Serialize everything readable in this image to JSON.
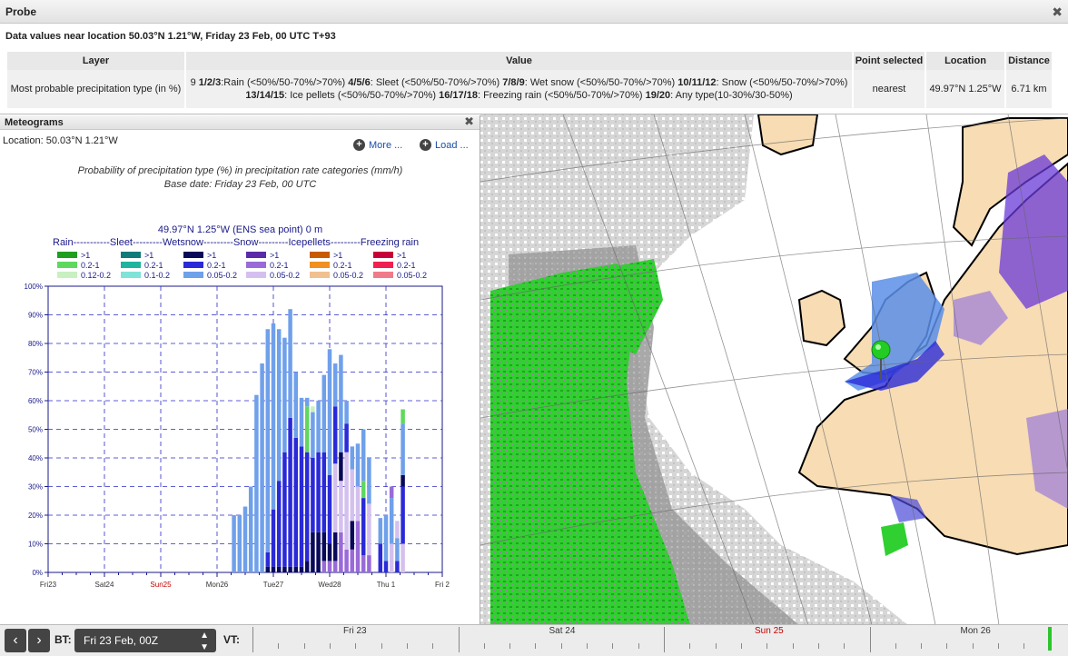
{
  "probe": {
    "title": "Probe",
    "subtitle": "Data values near location 50.03°N 1.21°W, Friday 23 Feb, 00 UTC T+93",
    "headers": [
      "Layer",
      "Value",
      "Point selected",
      "Location",
      "Distance"
    ],
    "row": {
      "layer": "Most probable precipitation type (in %)",
      "value_line1_prefix": "9 ",
      "value_line1": [
        {
          "b": "1/2/3",
          "t": ":Rain (<50%/50-70%/>70%) "
        },
        {
          "b": "4/5/6",
          "t": ": Sleet (<50%/50-70%/>70%) "
        },
        {
          "b": "7/8/9",
          "t": ": Wet snow (<50%/50-70%/>70%) "
        },
        {
          "b": "10/11/12",
          "t": ": Snow (<50%/50-70%/>70%)"
        }
      ],
      "value_line2": [
        {
          "b": "13/14/15",
          "t": ": Ice pellets (<50%/50-70%/>70%) "
        },
        {
          "b": "16/17/18",
          "t": ": Freezing rain (<50%/50-70%/>70%) "
        },
        {
          "b": "19/20",
          "t": ": Any type(10-30%/30-50%)"
        }
      ],
      "point_selected": "nearest",
      "location": "49.97°N 1.25°W",
      "distance": "6.71 km"
    }
  },
  "meteogram": {
    "title": "Meteograms",
    "location": "Location: 50.03°N 1.21°W",
    "more_label": "More ...",
    "load_label": "Load ...",
    "chart_title": "Probability of precipitation type (%) in precipitation rate categories (mm/h)",
    "base_date": "Base date: Friday 23 Feb, 00 UTC",
    "point_label": "49.97°N 1.25°W (ENS sea point) 0 m",
    "legend_header": "Rain-----------Sleet---------Wetsnow---------Snow---------Icepellets---------Freezing rain",
    "legend": [
      {
        "items": [
          {
            "label": ">1",
            "color": "#1f9e1f"
          },
          {
            "label": "0.2-1",
            "color": "#5fd85f"
          },
          {
            "label": "0.12-0.2",
            "color": "#c8f0c0"
          }
        ]
      },
      {
        "items": [
          {
            "label": ">1",
            "color": "#117a7a"
          },
          {
            "label": "0.2-1",
            "color": "#1fb3a0"
          },
          {
            "label": "0.1-0.2",
            "color": "#7fe3d8"
          }
        ]
      },
      {
        "items": [
          {
            "label": ">1",
            "color": "#0a0a5a"
          },
          {
            "label": "0.2-1",
            "color": "#2a2ad8"
          },
          {
            "label": "0.05-0.2",
            "color": "#6fa0ea"
          }
        ]
      },
      {
        "items": [
          {
            "label": ">1",
            "color": "#5a2aa8"
          },
          {
            "label": "0.2-1",
            "color": "#9a6ad8"
          },
          {
            "label": "0.05-0.2",
            "color": "#d4c0ee"
          }
        ]
      },
      {
        "items": [
          {
            "label": ">1",
            "color": "#c85a00"
          },
          {
            "label": "0.2-1",
            "color": "#f09020"
          },
          {
            "label": "0.05-0.2",
            "color": "#f0c090"
          }
        ]
      },
      {
        "items": [
          {
            "label": ">1",
            "color": "#c8003a"
          },
          {
            "label": "0.2-1",
            "color": "#f02050"
          },
          {
            "label": "0.05-0.2",
            "color": "#f07a8a"
          }
        ]
      }
    ]
  },
  "chart_data": {
    "type": "bar",
    "stacked": true,
    "ylim": [
      0,
      100
    ],
    "yticks": [
      "0%",
      "10%",
      "20%",
      "30%",
      "40%",
      "50%",
      "60%",
      "70%",
      "80%",
      "90%",
      "100%"
    ],
    "xticks": [
      {
        "label": "Fri23",
        "day": 0,
        "color": "#333"
      },
      {
        "label": "Sat24",
        "day": 1,
        "color": "#333"
      },
      {
        "label": "Sun25",
        "day": 2,
        "color": "#c00000"
      },
      {
        "label": "Mon26",
        "day": 3,
        "color": "#333"
      },
      {
        "label": "Tue27",
        "day": 4,
        "color": "#333"
      },
      {
        "label": "Wed28",
        "day": 5,
        "color": "#333"
      },
      {
        "label": "Thu 1",
        "day": 6,
        "color": "#333"
      },
      {
        "label": "Fri 2",
        "day": 7,
        "color": "#333"
      }
    ],
    "grid": true,
    "series_colors": {
      "wet_light": "#6fa0ea",
      "wet_mid": "#2a2ad8",
      "wet_heavy": "#0a0a5a",
      "snow_light": "#d4c0ee",
      "snow_mid": "#9a6ad8",
      "snow_heavy": "#5a2aa8",
      "rain_mid": "#5fd85f",
      "rain_light": "#c8f0c0",
      "sleet_light": "#7fe3d8"
    },
    "bars": [
      {
        "t": 3.3,
        "s": [
          [
            "wet_light",
            20
          ]
        ]
      },
      {
        "t": 3.4,
        "s": [
          [
            "wet_light",
            20
          ]
        ]
      },
      {
        "t": 3.5,
        "s": [
          [
            "wet_light",
            23
          ]
        ]
      },
      {
        "t": 3.6,
        "s": [
          [
            "wet_light",
            30
          ]
        ]
      },
      {
        "t": 3.7,
        "s": [
          [
            "wet_light",
            62
          ]
        ]
      },
      {
        "t": 3.8,
        "s": [
          [
            "wet_light",
            73
          ]
        ]
      },
      {
        "t": 3.9,
        "s": [
          [
            "wet_heavy",
            2
          ],
          [
            "wet_mid",
            5
          ],
          [
            "wet_light",
            78
          ]
        ]
      },
      {
        "t": 4.0,
        "s": [
          [
            "wet_heavy",
            2
          ],
          [
            "wet_mid",
            20
          ],
          [
            "wet_light",
            65
          ]
        ]
      },
      {
        "t": 4.1,
        "s": [
          [
            "wet_heavy",
            2
          ],
          [
            "wet_mid",
            30
          ],
          [
            "wet_light",
            53
          ]
        ]
      },
      {
        "t": 4.2,
        "s": [
          [
            "wet_heavy",
            2
          ],
          [
            "wet_mid",
            40
          ],
          [
            "wet_light",
            40
          ]
        ]
      },
      {
        "t": 4.3,
        "s": [
          [
            "wet_heavy",
            2
          ],
          [
            "wet_mid",
            52
          ],
          [
            "wet_light",
            38
          ]
        ]
      },
      {
        "t": 4.4,
        "s": [
          [
            "wet_heavy",
            2
          ],
          [
            "wet_mid",
            45
          ],
          [
            "wet_light",
            23
          ]
        ]
      },
      {
        "t": 4.5,
        "s": [
          [
            "wet_heavy",
            2
          ],
          [
            "wet_mid",
            42
          ],
          [
            "wet_light",
            17
          ]
        ]
      },
      {
        "t": 4.6,
        "s": [
          [
            "wet_heavy",
            4
          ],
          [
            "wet_mid",
            38
          ],
          [
            "rain_mid",
            16
          ],
          [
            "wet_light",
            3
          ]
        ]
      },
      {
        "t": 4.7,
        "s": [
          [
            "wet_heavy",
            14
          ],
          [
            "wet_mid",
            26
          ],
          [
            "wet_light",
            16
          ],
          [
            "rain_light",
            2
          ]
        ]
      },
      {
        "t": 4.8,
        "s": [
          [
            "wet_heavy",
            14
          ],
          [
            "wet_mid",
            28
          ],
          [
            "wet_light",
            18
          ]
        ]
      },
      {
        "t": 4.9,
        "s": [
          [
            "snow_mid",
            4
          ],
          [
            "wet_heavy",
            10
          ],
          [
            "wet_mid",
            28
          ],
          [
            "wet_light",
            27
          ]
        ]
      },
      {
        "t": 5.0,
        "s": [
          [
            "snow_mid",
            4
          ],
          [
            "wet_heavy",
            6
          ],
          [
            "wet_mid",
            24
          ],
          [
            "wet_light",
            44
          ]
        ]
      },
      {
        "t": 5.1,
        "s": [
          [
            "snow_mid",
            4
          ],
          [
            "wet_heavy",
            10
          ],
          [
            "snow_light",
            24
          ],
          [
            "wet_mid",
            20
          ],
          [
            "wet_light",
            15
          ]
        ]
      },
      {
        "t": 5.2,
        "s": [
          [
            "snow_mid",
            14
          ],
          [
            "snow_light",
            18
          ],
          [
            "wet_heavy",
            10
          ],
          [
            "wet_light",
            34
          ]
        ]
      },
      {
        "t": 5.3,
        "s": [
          [
            "snow_mid",
            8
          ],
          [
            "snow_light",
            34
          ],
          [
            "wet_mid",
            10
          ],
          [
            "wet_light",
            8
          ]
        ]
      },
      {
        "t": 5.4,
        "s": [
          [
            "snow_mid",
            8
          ],
          [
            "wet_heavy",
            10
          ],
          [
            "snow_light",
            18
          ],
          [
            "wet_light",
            8
          ]
        ]
      },
      {
        "t": 5.5,
        "s": [
          [
            "snow_mid",
            18
          ],
          [
            "snow_light",
            12
          ],
          [
            "wet_light",
            15
          ]
        ]
      },
      {
        "t": 5.6,
        "s": [
          [
            "snow_mid",
            6
          ],
          [
            "wet_mid",
            20
          ],
          [
            "rain_mid",
            6
          ],
          [
            "wet_light",
            18
          ]
        ]
      },
      {
        "t": 5.7,
        "s": [
          [
            "snow_mid",
            6
          ],
          [
            "snow_light",
            18
          ],
          [
            "wet_light",
            16
          ]
        ]
      },
      {
        "t": 5.9,
        "s": [
          [
            "wet_mid",
            10
          ],
          [
            "wet_light",
            9
          ]
        ]
      },
      {
        "t": 6.0,
        "s": [
          [
            "wet_mid",
            4
          ],
          [
            "wet_light",
            16
          ]
        ]
      },
      {
        "t": 6.1,
        "s": [
          [
            "snow_light",
            10
          ],
          [
            "wet_light",
            16
          ],
          [
            "snow_mid",
            4
          ]
        ]
      },
      {
        "t": 6.2,
        "s": [
          [
            "wet_mid",
            4
          ],
          [
            "wet_light",
            8
          ],
          [
            "snow_light",
            6
          ]
        ]
      },
      {
        "t": 6.3,
        "s": [
          [
            "snow_light",
            10
          ],
          [
            "wet_mid",
            20
          ],
          [
            "wet_heavy",
            4
          ],
          [
            "wet_light",
            18
          ],
          [
            "rain_mid",
            5
          ]
        ]
      }
    ]
  },
  "map": {
    "marker": "selected-point"
  },
  "timeline": {
    "bt_label": "BT:",
    "bt_value": "Fri 23 Feb, 00Z",
    "vt_label": "VT:",
    "days": [
      {
        "label": "Fri 23",
        "color": "#333"
      },
      {
        "label": "Sat 24",
        "color": "#333"
      },
      {
        "label": "Sun 25",
        "color": "#c00000"
      },
      {
        "label": "Mon 26",
        "color": "#333"
      }
    ]
  }
}
